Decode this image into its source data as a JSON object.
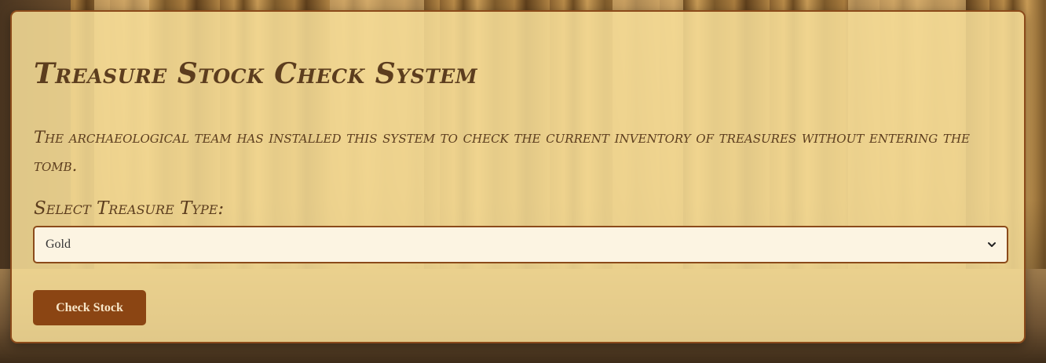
{
  "page": {
    "title": "Treasure Stock Check System",
    "description": "The archaeological team has installed this system to check the current inventory of treasures without entering the tomb."
  },
  "form": {
    "select_label": "Select Treasure Type:",
    "selected_value": "Gold",
    "check_button_label": "Check Stock"
  },
  "icons": {
    "dropdown": "chevron-down-icon"
  },
  "colors": {
    "panel_background": "#f7de99",
    "panel_border": "#8b4a1a",
    "heading_text": "#5c3d1e",
    "button_background": "#8b4513",
    "button_text": "#f7e6c8",
    "select_background": "#fcf4e2"
  }
}
